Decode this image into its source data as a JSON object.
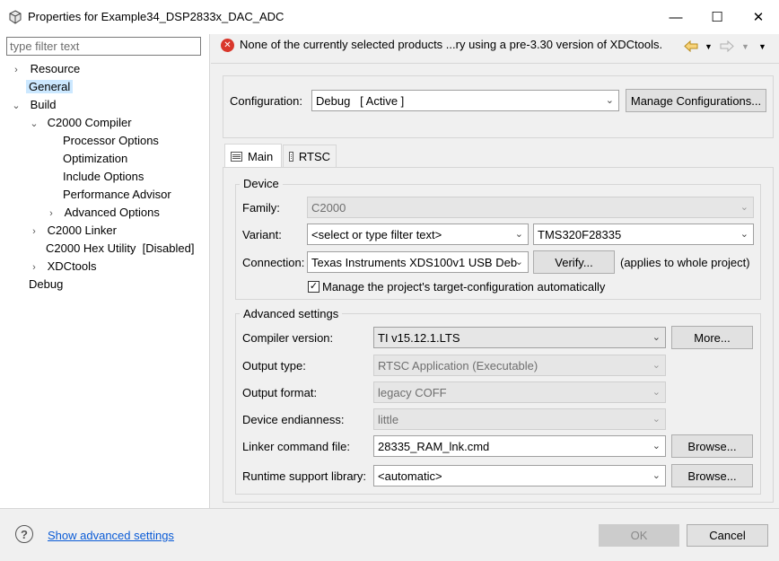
{
  "window": {
    "title": "Properties for Example34_DSP2833x_DAC_ADC",
    "minimize_glyph": "—",
    "maximize_glyph": "☐",
    "close_glyph": "✕"
  },
  "filter": {
    "placeholder": "type filter text"
  },
  "tree": {
    "resource": "Resource",
    "general": "General",
    "build": "Build",
    "c2000_compiler": "C2000 Compiler",
    "processor_options": "Processor Options",
    "optimization": "Optimization",
    "include_options": "Include Options",
    "performance_advisor": "Performance Advisor",
    "advanced_options": "Advanced Options",
    "c2000_linker": "C2000 Linker",
    "c2000_hex_utility": "C2000 Hex Utility  [Disabled]",
    "xdctools": "XDCtools",
    "debug": "Debug"
  },
  "message": {
    "text": "None of the currently selected products ...ry using a pre-3.30 version of XDCtools.",
    "icon": "error-icon"
  },
  "configuration": {
    "label": "Configuration:",
    "value": "Debug   [ Active ]",
    "manage_button": "Manage Configurations..."
  },
  "tabs": {
    "main": "Main",
    "rtsc": "RTSC"
  },
  "device": {
    "group_title": "Device",
    "family_label": "Family:",
    "family_value": "C2000",
    "variant_label": "Variant:",
    "variant_filter": "<select or type filter text>",
    "variant_value": "TMS320F28335",
    "connection_label": "Connection:",
    "connection_value": "Texas Instruments XDS100v1 USB Deb",
    "verify_button": "Verify...",
    "applies_note": "(applies to whole project)",
    "manage_checkbox_label": "Manage the project's target-configuration automatically",
    "manage_checked": true
  },
  "advanced": {
    "group_title": "Advanced settings",
    "compiler_label": "Compiler version:",
    "compiler_value": "TI v15.12.1.LTS",
    "more_button": "More...",
    "output_type_label": "Output type:",
    "output_type_value": "RTSC Application (Executable)",
    "output_format_label": "Output format:",
    "output_format_value": "legacy COFF",
    "endianness_label": "Device endianness:",
    "endianness_value": "little",
    "linker_label": "Linker command file:",
    "linker_value": "28335_RAM_lnk.cmd",
    "browse_button": "Browse...",
    "runtime_label": "Runtime support library:",
    "runtime_value": "<automatic>",
    "browse_button_2": "Browse..."
  },
  "footer": {
    "advanced_link": "Show advanced settings",
    "ok_button": "OK",
    "cancel_button": "Cancel"
  },
  "colors": {
    "selection": "#cce8ff",
    "link": "#0a5bd6",
    "error": "#d9372b"
  }
}
